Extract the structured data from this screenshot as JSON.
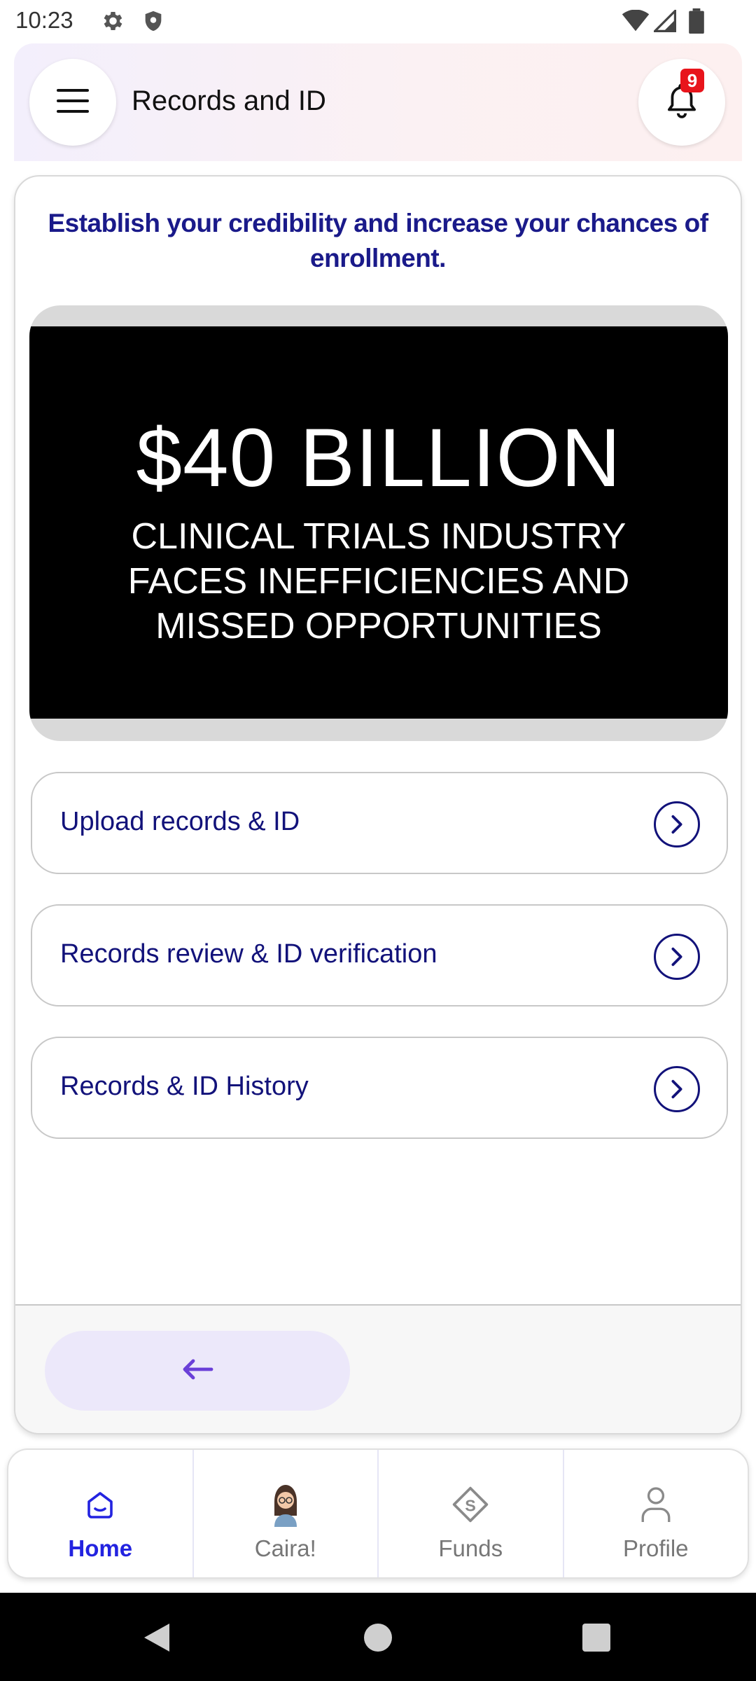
{
  "status_bar": {
    "time": "10:23",
    "icons": [
      "settings-icon",
      "shield-icon",
      "wifi-icon",
      "signal-icon",
      "battery-icon"
    ]
  },
  "header": {
    "title": "Records and ID",
    "notification_count": "9",
    "icons": [
      "menu-icon",
      "bell-icon"
    ]
  },
  "main": {
    "tagline": "Establish your credibility and increase your chances of enrollment.",
    "banner": {
      "headline": "$40 BILLION",
      "subline": "CLINICAL TRIALS INDUSTRY\nFACES INEFFICIENCIES AND\nMISSED OPPORTUNITIES"
    },
    "actions": [
      {
        "label": "Upload records & ID",
        "icon": "chevron-right-icon"
      },
      {
        "label": "Records review & ID verification",
        "icon": "chevron-right-icon"
      },
      {
        "label": "Records & ID History",
        "icon": "chevron-right-icon"
      }
    ],
    "back_icon": "arrow-left-icon"
  },
  "bottom_nav": {
    "items": [
      {
        "label": "Home",
        "icon": "home-icon",
        "active": true
      },
      {
        "label": "Caira!",
        "icon": "avatar-icon",
        "active": false
      },
      {
        "label": "Funds",
        "icon": "funds-icon",
        "active": false
      },
      {
        "label": "Profile",
        "icon": "profile-icon",
        "active": false
      }
    ]
  },
  "colors": {
    "accent": "#2323e0",
    "text_primary": "#12127a",
    "badge": "#e8141b",
    "back_button_bg": "#ece8fa"
  }
}
